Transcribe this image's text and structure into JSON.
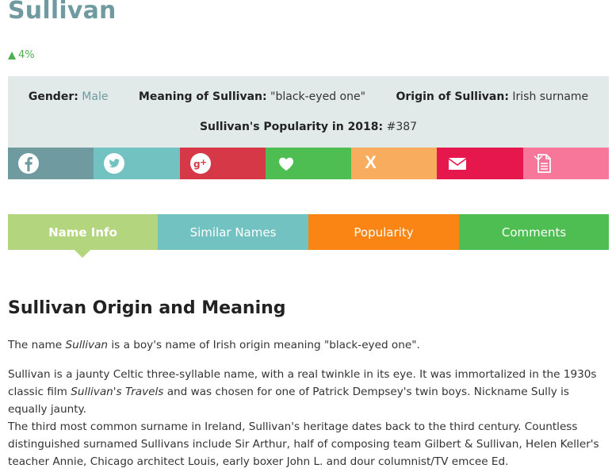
{
  "name_title": "Sullivan",
  "trend": {
    "direction": "up",
    "value": "4%",
    "color": "#4caf50"
  },
  "info": {
    "gender_label": "Gender:",
    "gender_value": "Male",
    "meaning_label": "Meaning of Sullivan:",
    "meaning_value": "\"black-eyed one\"",
    "origin_label": "Origin of Sullivan:",
    "origin_value": "Irish surname",
    "popularity_label": "Sullivan's Popularity in 2018:",
    "popularity_value": "#387"
  },
  "share_buttons": [
    {
      "icon": "facebook-icon",
      "color": "#6f9aa0"
    },
    {
      "icon": "twitter-icon",
      "color": "#73c2c2"
    },
    {
      "icon": "google-plus-icon",
      "color": "#d63847"
    },
    {
      "icon": "heart-icon",
      "color": "#4ebe53"
    },
    {
      "icon": "x-icon",
      "label": "X",
      "color": "#f8ac5e"
    },
    {
      "icon": "mail-icon",
      "color": "#e6174d"
    },
    {
      "icon": "document-icon",
      "color": "#f6779a"
    }
  ],
  "tabs": [
    {
      "label": "Name Info",
      "active": true,
      "color": "#b3d57d"
    },
    {
      "label": "Similar Names",
      "active": false,
      "color": "#73c2c2"
    },
    {
      "label": "Popularity",
      "active": false,
      "color": "#fa8514"
    },
    {
      "label": "Comments",
      "active": false,
      "color": "#4ebe53"
    }
  ],
  "section_heading": "Sullivan Origin and Meaning",
  "paragraphs": {
    "p1_pre": "The name ",
    "p1_em": "Sullivan",
    "p1_post": " is a boy's name of Irish origin meaning \"black-eyed one\".",
    "p2_pre": "Sullivan is a jaunty Celtic three-syllable name, with a real twinkle in its eye. It was immortalized in the 1930s classic film ",
    "p2_em": "Sullivan's Travels",
    "p2_post": " and was chosen for one of Patrick Dempsey's twin boys. Nickname Sully is equally jaunty.",
    "p3": "The third most common surname in Ireland, Sullivan's heritage dates back to the third century. Countless distin­guished surnamed Sullivans include Sir Arthur, half of composing team Gilbert & Sullivan, Helen Keller's teacher An­nie, Chicago architect Louis, early boxer John L. and dour columnist/TV emcee Ed."
  }
}
